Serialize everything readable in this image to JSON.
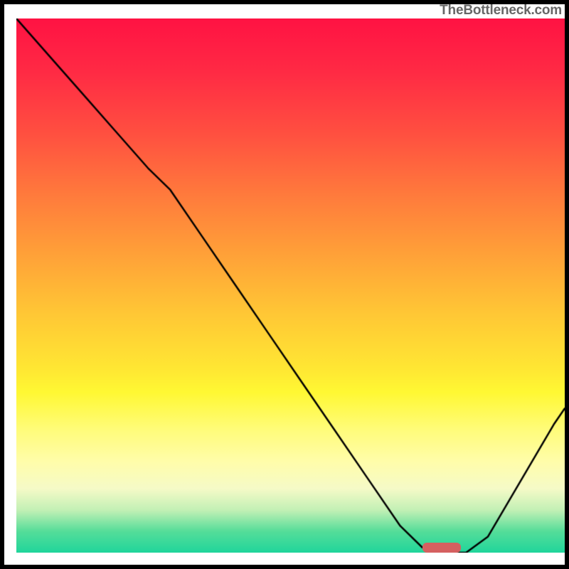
{
  "watermark": "TheBottleneck.com",
  "chart_data": {
    "type": "line",
    "x": [
      0.0,
      0.06,
      0.12,
      0.18,
      0.24,
      0.28,
      0.34,
      0.4,
      0.46,
      0.52,
      0.58,
      0.64,
      0.7,
      0.74,
      0.78,
      0.82,
      0.86,
      0.9,
      0.94,
      0.98,
      1.0
    ],
    "series": [
      {
        "name": "bottleneck-curve",
        "values": [
          1.0,
          0.93,
          0.86,
          0.79,
          0.72,
          0.68,
          0.59,
          0.5,
          0.41,
          0.32,
          0.23,
          0.14,
          0.05,
          0.01,
          0.0,
          0.0,
          0.03,
          0.1,
          0.17,
          0.24,
          0.27
        ]
      }
    ],
    "title": "",
    "xlabel": "",
    "ylabel": "",
    "ylim": [
      0,
      1
    ],
    "xlim": [
      0,
      1
    ],
    "marker": {
      "x_center": 0.775,
      "y": 0.0,
      "width": 0.07,
      "height": 0.018
    }
  }
}
